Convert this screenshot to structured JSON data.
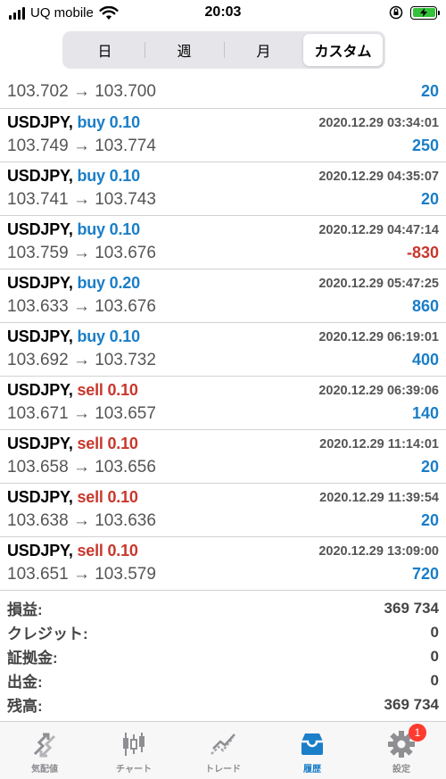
{
  "status_bar": {
    "carrier": "UQ mobile",
    "time": "20:03"
  },
  "segments": [
    {
      "label": "日",
      "active": false
    },
    {
      "label": "週",
      "active": false
    },
    {
      "label": "月",
      "active": false
    },
    {
      "label": "カスタム",
      "active": true
    }
  ],
  "partial_row": {
    "prices": "103.702 → 103.700",
    "profit": "20",
    "profit_sign": "pos"
  },
  "trades": [
    {
      "symbol": "USDJPY,",
      "direction": "buy 0.10",
      "type": "buy",
      "time": "2020.12.29 03:34:01",
      "prices": "103.749 → 103.774",
      "profit": "250",
      "profit_sign": "pos"
    },
    {
      "symbol": "USDJPY,",
      "direction": "buy 0.10",
      "type": "buy",
      "time": "2020.12.29 04:35:07",
      "prices": "103.741 → 103.743",
      "profit": "20",
      "profit_sign": "pos"
    },
    {
      "symbol": "USDJPY,",
      "direction": "buy 0.10",
      "type": "buy",
      "time": "2020.12.29 04:47:14",
      "prices": "103.759 → 103.676",
      "profit": "-830",
      "profit_sign": "neg"
    },
    {
      "symbol": "USDJPY,",
      "direction": "buy 0.20",
      "type": "buy",
      "time": "2020.12.29 05:47:25",
      "prices": "103.633 → 103.676",
      "profit": "860",
      "profit_sign": "pos"
    },
    {
      "symbol": "USDJPY,",
      "direction": "buy 0.10",
      "type": "buy",
      "time": "2020.12.29 06:19:01",
      "prices": "103.692 → 103.732",
      "profit": "400",
      "profit_sign": "pos"
    },
    {
      "symbol": "USDJPY,",
      "direction": "sell 0.10",
      "type": "sell",
      "time": "2020.12.29 06:39:06",
      "prices": "103.671 → 103.657",
      "profit": "140",
      "profit_sign": "pos"
    },
    {
      "symbol": "USDJPY,",
      "direction": "sell 0.10",
      "type": "sell",
      "time": "2020.12.29 11:14:01",
      "prices": "103.658 → 103.656",
      "profit": "20",
      "profit_sign": "pos"
    },
    {
      "symbol": "USDJPY,",
      "direction": "sell 0.10",
      "type": "sell",
      "time": "2020.12.29 11:39:54",
      "prices": "103.638 → 103.636",
      "profit": "20",
      "profit_sign": "pos"
    },
    {
      "symbol": "USDJPY,",
      "direction": "sell 0.10",
      "type": "sell",
      "time": "2020.12.29 13:09:00",
      "prices": "103.651 → 103.579",
      "profit": "720",
      "profit_sign": "pos"
    }
  ],
  "summary": [
    {
      "label": "損益:",
      "value": "369 734"
    },
    {
      "label": "クレジット:",
      "value": "0"
    },
    {
      "label": "証拠金:",
      "value": "0"
    },
    {
      "label": "出金:",
      "value": "0"
    },
    {
      "label": "残高:",
      "value": "369 734"
    }
  ],
  "tabbar": [
    {
      "label": "気配値",
      "icon": "quotes-icon",
      "active": false
    },
    {
      "label": "チャート",
      "icon": "chart-icon",
      "active": false
    },
    {
      "label": "トレード",
      "icon": "trade-icon",
      "active": false
    },
    {
      "label": "履歴",
      "icon": "history-icon",
      "active": true
    },
    {
      "label": "設定",
      "icon": "settings-icon",
      "active": false,
      "badge": "1"
    }
  ],
  "colors": {
    "buy": "#1a7ec8",
    "sell": "#c9372c",
    "profit_positive": "#1a7ec8",
    "profit_negative": "#c9372c",
    "active_tab": "#1a7ec8",
    "badge": "#ff3b30"
  }
}
